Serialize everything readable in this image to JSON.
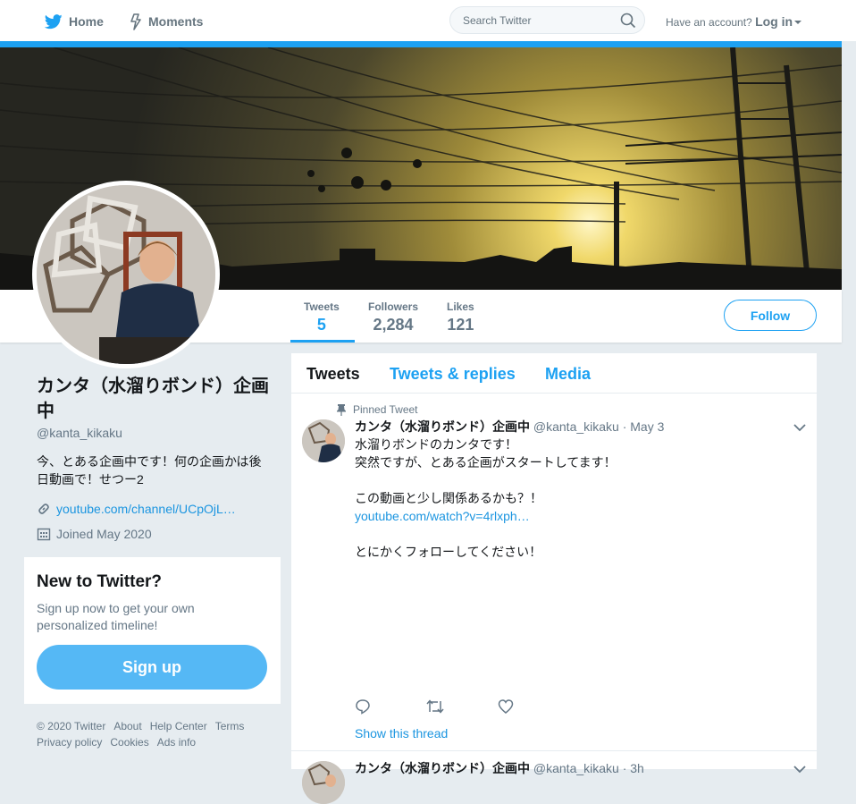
{
  "nav": {
    "home": "Home",
    "moments": "Moments",
    "search_placeholder": "Search Twitter",
    "have_account": "Have an account?",
    "login": "Log in"
  },
  "stats": {
    "tweets_label": "Tweets",
    "tweets_value": "5",
    "followers_label": "Followers",
    "followers_value": "2,284",
    "likes_label": "Likes",
    "likes_value": "121",
    "follow_button": "Follow"
  },
  "profile": {
    "name": "カンタ（水溜りボンド）企画中",
    "handle": "@kanta_kikaku",
    "bio": "今、とある企画中です！何の企画かは後日動画で！せつー2",
    "url": "youtube.com/channel/UCpOjL…",
    "joined": "Joined May 2020"
  },
  "signup_card": {
    "title": "New to Twitter?",
    "text": "Sign up now to get your own personalized timeline!",
    "button": "Sign up"
  },
  "footer": {
    "links": [
      "© 2020 Twitter",
      "About",
      "Help Center",
      "Terms",
      "Privacy policy",
      "Cookies",
      "Ads info"
    ]
  },
  "timeline": {
    "tabs": [
      "Tweets",
      "Tweets & replies",
      "Media"
    ],
    "pinned_label": "Pinned Tweet",
    "tweet": {
      "name": "カンタ（水溜りボンド）企画中",
      "handle": "@kanta_kikaku",
      "date": "· May 3",
      "line1": "水溜りボンドのカンタです！",
      "line2": "突然ですが、とある企画がスタートしてます！",
      "line3": "この動画と少し関係あるかも？！",
      "link": "youtube.com/watch?v=4rlxph…",
      "line4": "とにかくフォローしてください！"
    },
    "show_thread": "Show this thread",
    "tweet2": {
      "name": "カンタ（水溜りボンド）企画中",
      "handle": "@kanta_kikaku",
      "date": "· 3h"
    }
  },
  "colors": {
    "accent": "#1da1f2",
    "link": "#1b95e0",
    "background": "#e6ecf0"
  },
  "icons": [
    "twitter-bird-icon",
    "lightning-icon",
    "search-icon",
    "link-icon",
    "calendar-icon",
    "pin-icon",
    "chevron-down-icon",
    "reply-icon",
    "retweet-icon",
    "like-icon"
  ]
}
